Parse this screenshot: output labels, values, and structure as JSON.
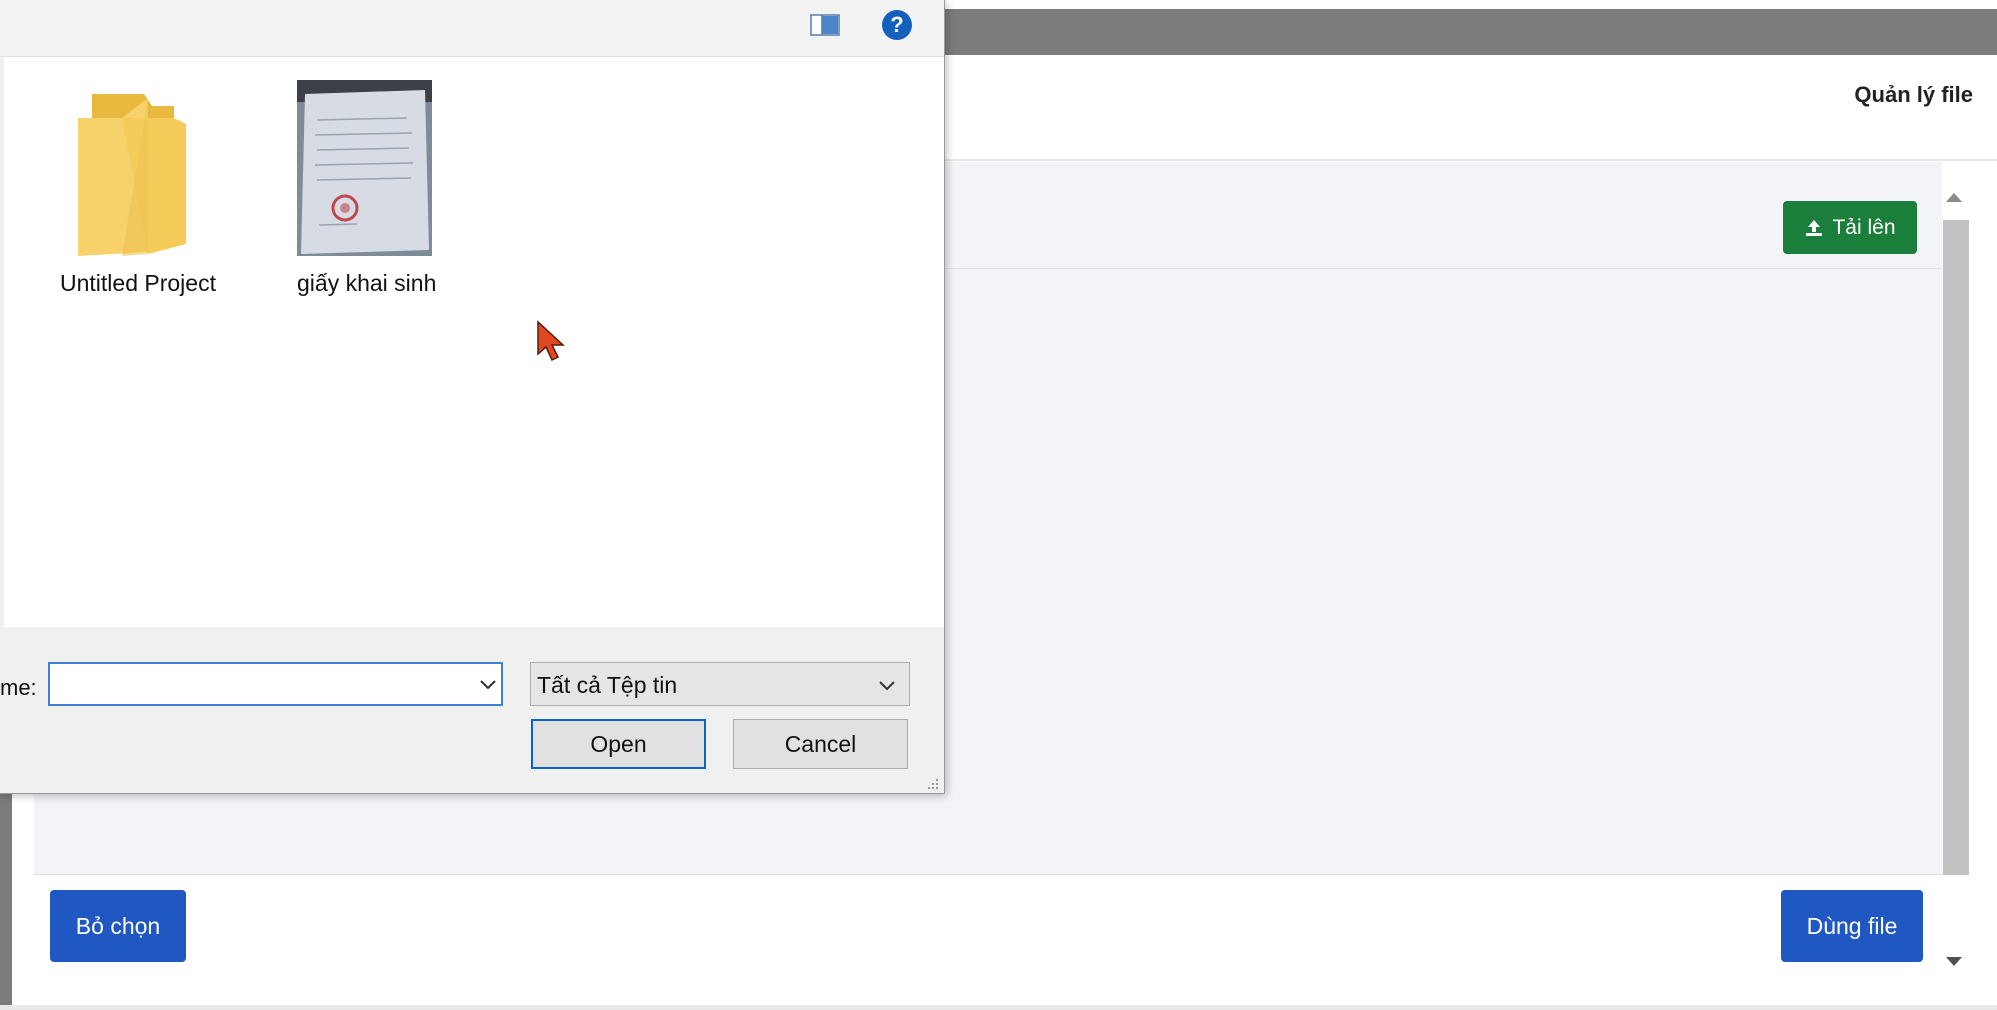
{
  "background_app": {
    "title": "Quản lý file",
    "upload_button": "Tải lên",
    "deselect_button": "Bỏ chọn",
    "use_file_button": "Dùng file",
    "colors": {
      "upload": "#1b7e3a",
      "primary": "#1f57c3",
      "topbar": "#7b7b7b"
    }
  },
  "dialog": {
    "files": [
      {
        "name": "Untitled Project",
        "icon": "folder-icon"
      },
      {
        "name": "giấy khai sinh",
        "icon": "image-thumbnail"
      }
    ],
    "filename_label": "me:",
    "filename_value": "",
    "filetype_selected": "Tất cả Tệp tin",
    "open_button": "Open",
    "cancel_button": "Cancel",
    "help_icon_text": "?"
  }
}
